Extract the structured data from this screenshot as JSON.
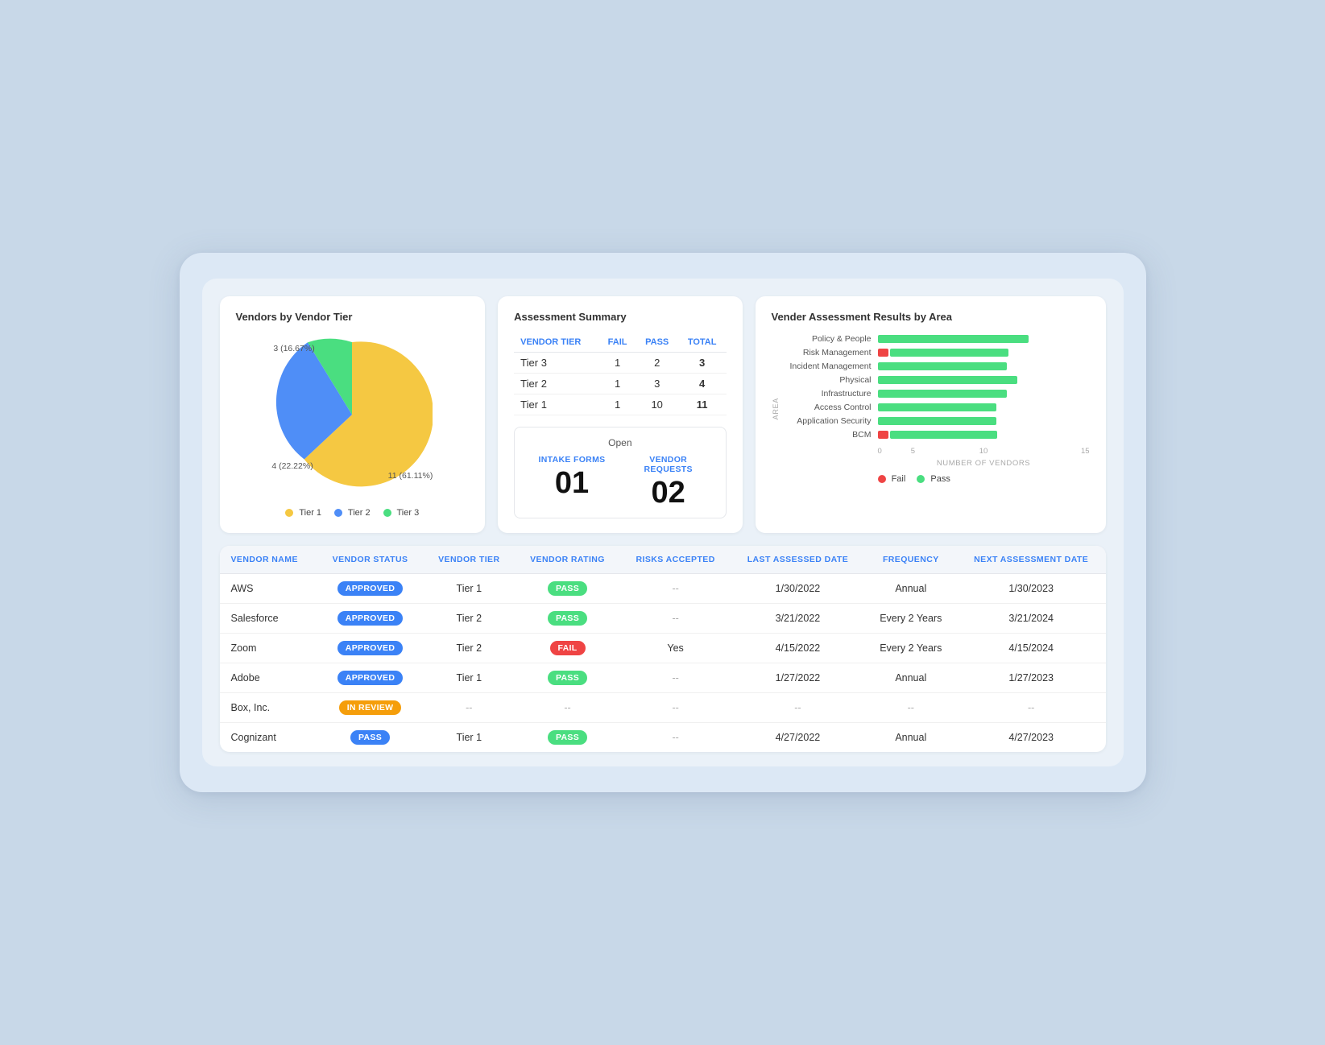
{
  "pie_chart": {
    "title": "Vendors by Vendor Tier",
    "segments": [
      {
        "label": "Tier 1",
        "value": 11,
        "pct": 61.11,
        "color": "#f5c842"
      },
      {
        "label": "Tier 2",
        "value": 4,
        "pct": 22.22,
        "color": "#4f8ef7"
      },
      {
        "label": "Tier 3",
        "value": 3,
        "pct": 16.67,
        "color": "#4ade80"
      }
    ],
    "labels": {
      "tier3": "3 (16.67%)",
      "tier2_val": "4 (22.22%)",
      "tier1_val": "11 (61.11%)"
    },
    "legend": [
      "Tier 1",
      "Tier 2",
      "Tier 3"
    ]
  },
  "assessment_summary": {
    "title": "Assessment Summary",
    "columns": [
      "VENDOR TIER",
      "FAIL",
      "PASS",
      "TOTAL"
    ],
    "rows": [
      {
        "tier": "Tier 3",
        "fail": 1,
        "pass": 2,
        "total": 3
      },
      {
        "tier": "Tier 2",
        "fail": 1,
        "pass": 3,
        "total": 4
      },
      {
        "tier": "Tier 1",
        "fail": 1,
        "pass": 10,
        "total": 11
      }
    ],
    "open": {
      "label": "Open",
      "intake_forms_label": "INTAKE FORMS",
      "intake_forms_value": "01",
      "vendor_requests_label": "VENDOR REQUESTS",
      "vendor_requests_value": "02"
    }
  },
  "bar_chart": {
    "title": "Vender Assessment Results by Area",
    "y_axis_label": "AREA",
    "x_axis_label": "NUMBER OF VENDORS",
    "x_ticks": [
      "0",
      "5",
      "10",
      "15"
    ],
    "max": 15,
    "rows": [
      {
        "label": "Policy & People",
        "fail": 0,
        "pass": 14
      },
      {
        "label": "Risk Management",
        "fail": 1,
        "pass": 11
      },
      {
        "label": "Incident Management",
        "fail": 0,
        "pass": 12
      },
      {
        "label": "Physical",
        "fail": 0,
        "pass": 13
      },
      {
        "label": "Infrastructure",
        "fail": 0,
        "pass": 12
      },
      {
        "label": "Access Control",
        "fail": 0,
        "pass": 11
      },
      {
        "label": "Application Security",
        "fail": 0,
        "pass": 11
      },
      {
        "label": "BCM",
        "fail": 1,
        "pass": 10
      }
    ],
    "legend": [
      "Fail",
      "Pass"
    ]
  },
  "vendor_table": {
    "columns": [
      "VENDOR NAME",
      "VENDOR STATUS",
      "VENDOR TIER",
      "VENDOR RATING",
      "RISKS ACCEPTED",
      "LAST ASSESSED DATE",
      "FREQUENCY",
      "NEXT ASSESSMENT DATE"
    ],
    "rows": [
      {
        "name": "AWS",
        "status": "APPROVED",
        "status_type": "approved",
        "tier": "Tier 1",
        "rating": "PASS",
        "rating_type": "pass",
        "risks": "--",
        "last_date": "1/30/2022",
        "frequency": "Annual",
        "next_date": "1/30/2023"
      },
      {
        "name": "Salesforce",
        "status": "APPROVED",
        "status_type": "approved",
        "tier": "Tier 2",
        "rating": "PASS",
        "rating_type": "pass",
        "risks": "--",
        "last_date": "3/21/2022",
        "frequency": "Every 2 Years",
        "next_date": "3/21/2024"
      },
      {
        "name": "Zoom",
        "status": "APPROVED",
        "status_type": "approved",
        "tier": "Tier 2",
        "rating": "FAIL",
        "rating_type": "fail",
        "risks": "Yes",
        "last_date": "4/15/2022",
        "frequency": "Every 2 Years",
        "next_date": "4/15/2024"
      },
      {
        "name": "Adobe",
        "status": "APPROVED",
        "status_type": "approved",
        "tier": "Tier 1",
        "rating": "PASS",
        "rating_type": "pass",
        "risks": "--",
        "last_date": "1/27/2022",
        "frequency": "Annual",
        "next_date": "1/27/2023"
      },
      {
        "name": "Box, Inc.",
        "status": "IN REVIEW",
        "status_type": "in-review",
        "tier": "--",
        "rating": "--",
        "rating_type": "none",
        "risks": "--",
        "last_date": "--",
        "frequency": "--",
        "next_date": "--"
      },
      {
        "name": "Cognizant",
        "status": "PASS",
        "status_type": "pass-status",
        "tier": "Tier 1",
        "rating": "PASS",
        "rating_type": "pass",
        "risks": "--",
        "last_date": "4/27/2022",
        "frequency": "Annual",
        "next_date": "4/27/2023"
      }
    ]
  }
}
